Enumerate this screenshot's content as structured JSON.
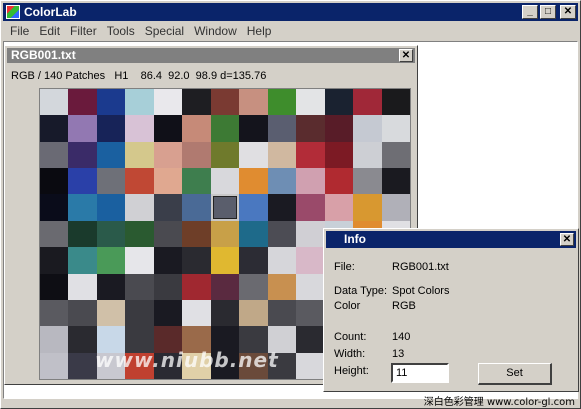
{
  "app": {
    "title": "ColorLab"
  },
  "menu": [
    "File",
    "Edit",
    "Filter",
    "Tools",
    "Special",
    "Window",
    "Help"
  ],
  "doc": {
    "title": "RGB001.txt",
    "status": "RGB / 140 Patches   H1    86.4  92.0  98.9 d=135.76",
    "selected_patch": 58,
    "patches": [
      "#d3d7dc",
      "#6a1a3c",
      "#1b3a8e",
      "#a7cfd8",
      "#e9e8ec",
      "#1e1e22",
      "#7a3a32",
      "#c79080",
      "#3e8d2c",
      "#e3e4e6",
      "#1a2230",
      "#a02838",
      "#1a1a1c",
      "#171a2a",
      "#9278b2",
      "#172358",
      "#d8c2d6",
      "#101018",
      "#c68a78",
      "#3d7a34",
      "#14141c",
      "#5a5e70",
      "#5a2c2e",
      "#581c28",
      "#c5c9d2",
      "#d8dadd",
      "#6a6a74",
      "#3a2b68",
      "#1a60a0",
      "#d4c88c",
      "#d8a090",
      "#b07a70",
      "#6f7a2c",
      "#e0dfe2",
      "#d0b8a0",
      "#b22c38",
      "#7c1a24",
      "#cdcfd4",
      "#6e6e74",
      "#0a0a10",
      "#2a40a8",
      "#6e7078",
      "#c04834",
      "#e0a890",
      "#3e7e4e",
      "#d8d8dc",
      "#e08c30",
      "#6e8eb4",
      "#d0a0b0",
      "#b02a30",
      "#8a8a90",
      "#1a1a20",
      "#0a0c1a",
      "#2a7aa8",
      "#1a60a0",
      "#d0d0d4",
      "#3a3e4a",
      "#4a6a96",
      "#5a5e6c",
      "#4a78c0",
      "#1a1a22",
      "#9a4a6a",
      "#d8a0a8",
      "#d89830",
      "#b0b0b8",
      "#6a6a70",
      "#1a3a2c",
      "#2a5a4a",
      "#2a5a30",
      "#4a4a50",
      "#6e3e28",
      "#c8a048",
      "#1e6a8a",
      "#4c4c54",
      "#d0cfd4",
      "#c8d0d8",
      "#e08c30",
      "#e0e0e4",
      "#1a1a20",
      "#3a8a8a",
      "#4a9a58",
      "#e6e6ea",
      "#1a1a22",
      "#2a2a30",
      "#e0b830",
      "#2c2c34",
      "#d6d6da",
      "#d8b8c8",
      "#1a1a22",
      "#c8c8cc",
      "#0c0c14",
      "#0e0e14",
      "#e0e0e4",
      "#1a1a22",
      "#4a4a50",
      "#3a3a40",
      "#a02830",
      "#5a2a40",
      "#6a6a70",
      "#c89050",
      "#d8d8dc",
      "#1a1a22",
      "#8a8a90",
      "#1a1a20",
      "#5a5a60",
      "#4a4a50",
      "#d0c0a8",
      "#3a3a40",
      "#1a1a22",
      "#e0e0e4",
      "#2a2a30",
      "#c0a888",
      "#4a4a50",
      "#5a5a60",
      "#9a9aa0",
      "#2a2a30",
      "#e0e0e4",
      "#b8b8c0",
      "#2a2a30",
      "#c8d8e8",
      "#3a3a40",
      "#5a2a2a",
      "#9a6a4a",
      "#1a1a22",
      "#3a3a40",
      "#d0d0d4",
      "#2a2a30",
      "#a0a0a8",
      "#4a4a50",
      "#e0e0e4",
      "#c0c0c8",
      "#3a3a48",
      "#c8c8d0",
      "#c04030",
      "#2a2a32",
      "#e0d0a8",
      "#1a1a22",
      "#6a4a3a",
      "#3a3a40",
      "#d8d8dc",
      "#2a2a30",
      "#8a8a90",
      "#1a1a22"
    ]
  },
  "watermark": "www.niubb.net",
  "info": {
    "title": "Info",
    "rows": [
      {
        "label": "File:",
        "value": "RGB001.txt"
      },
      {
        "label": "Data Type:",
        "value": "Spot Colors"
      },
      {
        "label": "Color",
        "value": "RGB"
      },
      {
        "label": "Count:",
        "value": "140"
      },
      {
        "label": "Width:",
        "value": "13"
      },
      {
        "label": "Height:",
        "value": ""
      }
    ],
    "height_value": "11",
    "set_label": "Set"
  },
  "footer": "深白色彩管理 www.color-gl.com",
  "colors": {
    "titlebar_active": "#0a246a",
    "titlebar_inactive": "#808080",
    "face": "#d4d0c8"
  }
}
